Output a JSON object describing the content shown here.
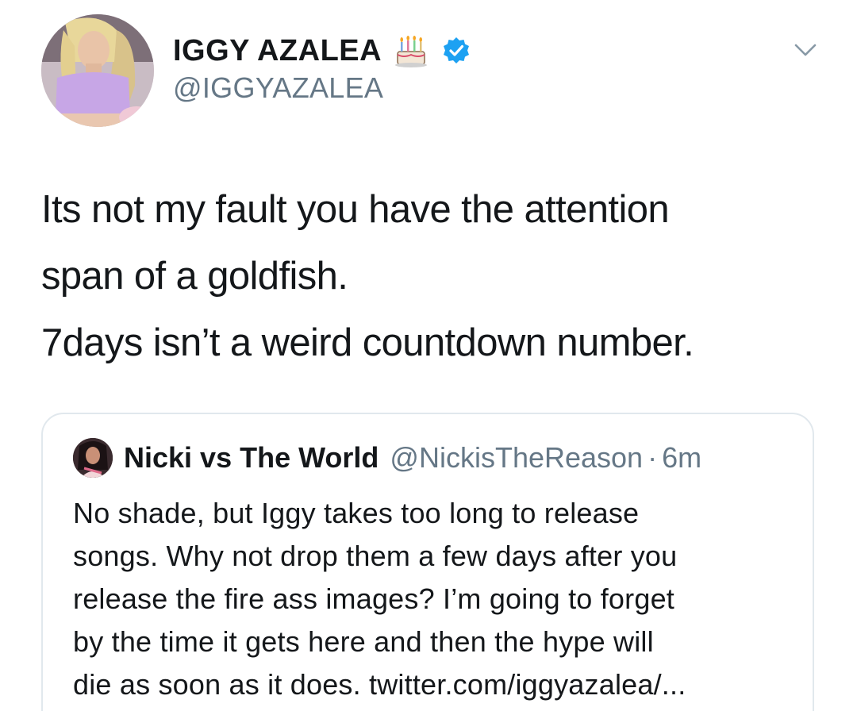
{
  "author": {
    "display_name": "IGGY AZALEA",
    "handle": "@IGGYAZALEA",
    "badges": [
      "birthday-cake-icon",
      "verified-icon"
    ],
    "verified_color": "#1da1f2"
  },
  "tweet": {
    "lines": [
      "Its not my fault you have the attention",
      "span of a goldfish.",
      "7days isn’t a weird countdown number."
    ]
  },
  "quoted_tweet": {
    "display_name": "Nicki vs The World",
    "handle": "@NickisTheReason",
    "separator": "·",
    "time": "6m",
    "lines": [
      "No shade, but Iggy takes too long to release",
      "songs. Why not drop them a few days after you",
      "release the fire ass images? I’m going to forget",
      "by the time it gets here and then the hype will",
      "die as soon as it does. twitter.com/iggyazalea/..."
    ]
  },
  "colors": {
    "text_primary": "#14171a",
    "text_secondary": "#657786",
    "border": "#e1e8ed",
    "verified_blue": "#1da1f2"
  }
}
